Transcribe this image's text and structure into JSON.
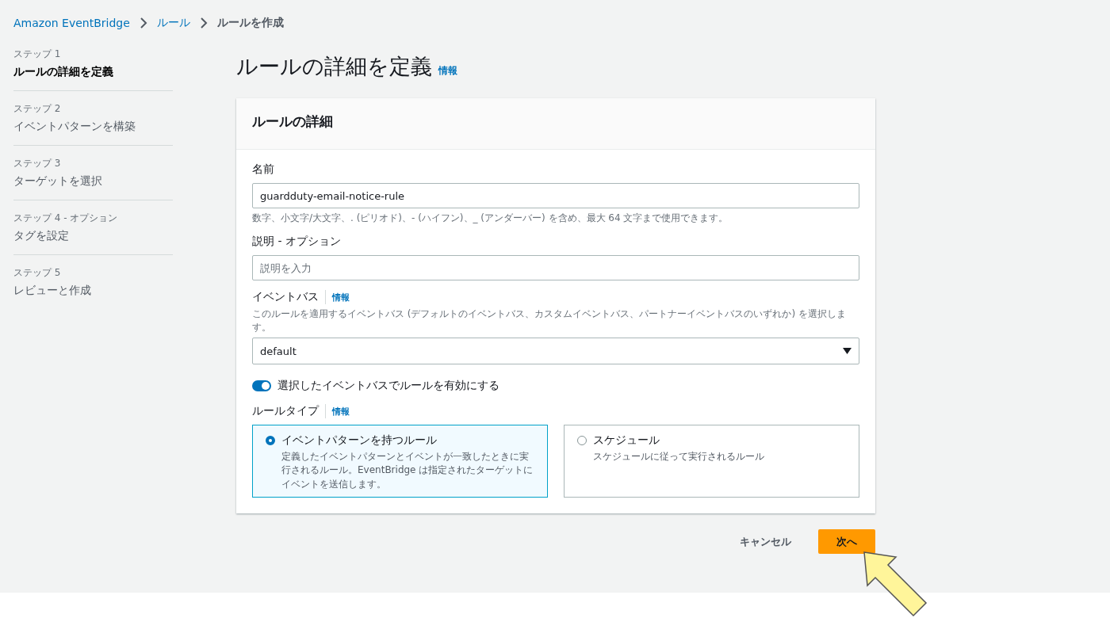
{
  "breadcrumb": [
    {
      "label": "Amazon EventBridge",
      "link": true
    },
    {
      "label": "ルール",
      "link": true
    },
    {
      "label": "ルールを作成",
      "link": false
    }
  ],
  "steps": [
    {
      "step": "ステップ 1",
      "title": "ルールの詳細を定義",
      "selected": true
    },
    {
      "step": "ステップ 2",
      "title": "イベントパターンを構築",
      "selected": false
    },
    {
      "step": "ステップ 3",
      "title": "ターゲットを選択",
      "selected": false
    },
    {
      "step": "ステップ 4 - オプション",
      "title": "タグを設定",
      "selected": false
    },
    {
      "step": "ステップ 5",
      "title": "レビューと作成",
      "selected": false
    }
  ],
  "page": {
    "title": "ルールの詳細を定義",
    "info": "情報"
  },
  "panel": {
    "title": "ルールの詳細",
    "name": {
      "label": "名前",
      "value": "guardduty-email-notice-rule",
      "hint": "数字、小文字/大文字、. (ピリオド)、- (ハイフン)、_ (アンダーバー) を含め、最大 64 文字まで使用できます。"
    },
    "description": {
      "label": "説明 - オプション",
      "placeholder": "説明を入力"
    },
    "event_bus": {
      "label": "イベントバス",
      "info": "情報",
      "hint": "このルールを適用するイベントバス (デフォルトのイベントバス、カスタムイベントバス、パートナーイベントバスのいずれか) を選択します。",
      "value": "default"
    },
    "enable_toggle": {
      "label": "選択したイベントバスでルールを有効にする",
      "on": true
    },
    "rule_type": {
      "label": "ルールタイプ",
      "info": "情報",
      "options": [
        {
          "title": "イベントパターンを持つルール",
          "description": "定義したイベントパターンとイベントが一致したときに実行されるルール。EventBridge は指定されたターゲットにイベントを送信します。",
          "selected": true
        },
        {
          "title": "スケジュール",
          "description": "スケジュールに従って実行されるルール",
          "selected": false
        }
      ]
    }
  },
  "actions": {
    "cancel": "キャンセル",
    "next": "次へ"
  }
}
